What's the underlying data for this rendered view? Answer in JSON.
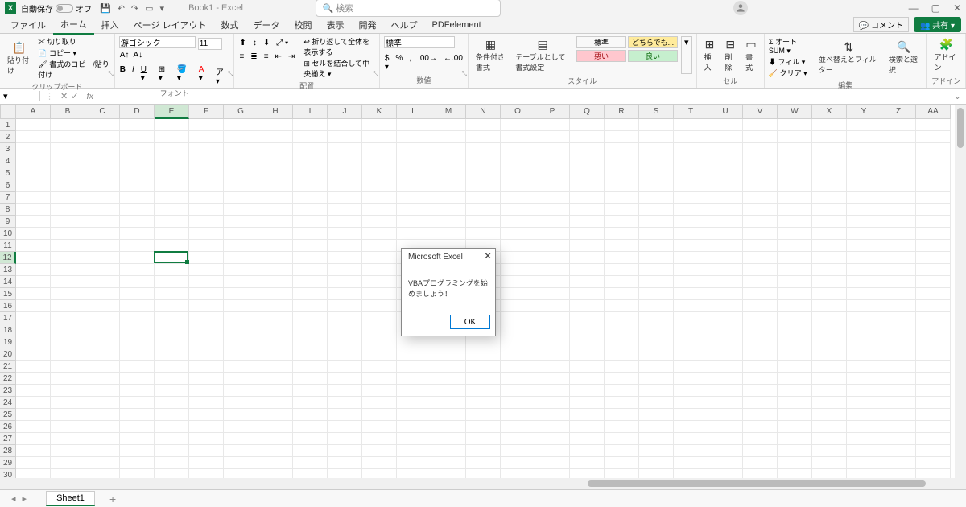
{
  "titlebar": {
    "autosave_label": "自動保存",
    "autosave_state": "オフ",
    "doc_name": "Book1 - Excel",
    "search_placeholder": "検索"
  },
  "tabs": {
    "file": "ファイル",
    "home": "ホーム",
    "insert": "挿入",
    "layout": "ページ レイアウト",
    "formulas": "数式",
    "data": "データ",
    "review": "校閲",
    "view": "表示",
    "developer": "開発",
    "help": "ヘルプ",
    "pdfelement": "PDFelement",
    "comments": "コメント",
    "share": "共有"
  },
  "ribbon": {
    "clipboard": {
      "paste": "貼り付け",
      "cut": "切り取り",
      "copy": "コピー",
      "format_painter": "書式のコピー/貼り付け",
      "group": "クリップボード"
    },
    "font": {
      "name": "游ゴシック",
      "size": "11",
      "group": "フォント"
    },
    "alignment": {
      "wrap": "折り返して全体を表示する",
      "merge": "セルを結合して中央揃え",
      "group": "配置"
    },
    "number": {
      "format": "標準",
      "group": "数値"
    },
    "styles": {
      "conditional": "条件付き書式",
      "table": "テーブルとして書式設定",
      "normal": "標準",
      "neutral": "どちらでも...",
      "bad": "悪い",
      "good": "良い",
      "group": "スタイル"
    },
    "cells": {
      "insert": "挿入",
      "delete": "削除",
      "format": "書式",
      "group": "セル"
    },
    "editing": {
      "autosum": "オート SUM",
      "fill": "フィル",
      "clear": "クリア",
      "sort": "並べ替えとフィルター",
      "find": "検索と選択",
      "group": "編集"
    },
    "addins": {
      "label": "アドイン",
      "group": "アドイン"
    }
  },
  "formula_bar": {
    "name_box": "",
    "fx": "fx"
  },
  "grid": {
    "columns": [
      "A",
      "B",
      "C",
      "D",
      "E",
      "F",
      "G",
      "H",
      "I",
      "J",
      "K",
      "L",
      "M",
      "N",
      "O",
      "P",
      "Q",
      "R",
      "S",
      "T",
      "U",
      "V",
      "W",
      "X",
      "Y",
      "Z",
      "AA"
    ],
    "rows": [
      1,
      2,
      3,
      4,
      5,
      6,
      7,
      8,
      9,
      10,
      11,
      12,
      13,
      14,
      15,
      16,
      17,
      18,
      19,
      20,
      21,
      22,
      23,
      24,
      25,
      26,
      27,
      28,
      29,
      30
    ],
    "active_col": "E",
    "active_row": 12
  },
  "sheet_tabs": {
    "sheet1": "Sheet1"
  },
  "dialog": {
    "title": "Microsoft Excel",
    "message": "VBAプログラミングを始めましょう！",
    "ok": "OK"
  }
}
